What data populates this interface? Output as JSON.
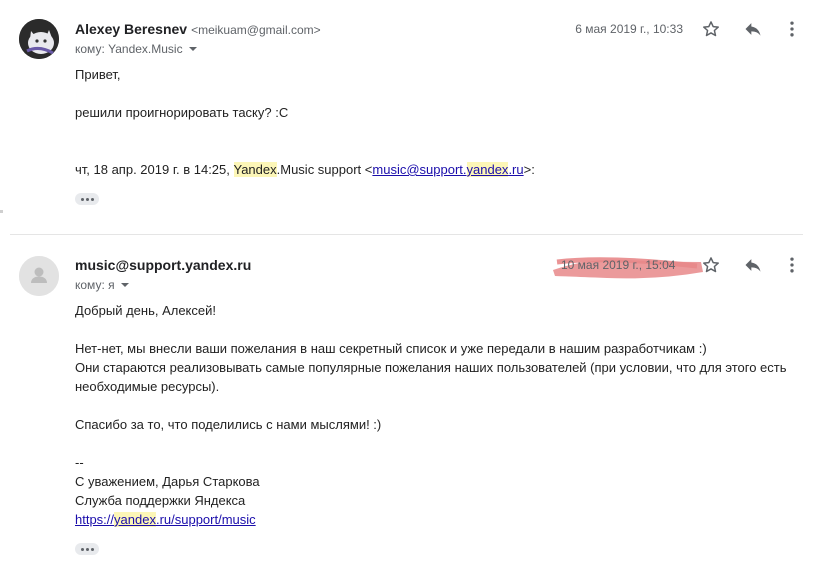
{
  "messages": [
    {
      "sender_name": "Alexey Beresnev",
      "sender_email": "<meikuam@gmail.com>",
      "recipient": "кому: Yandex.Music",
      "date": "6 мая 2019 г., 10:33",
      "greeting": "Привет,",
      "line1": "решили проигнорировать таску? :С",
      "quote_prefix": "чт, 18 апр. 2019 г. в 14:25, ",
      "quote_yandex": "Yandex",
      "quote_rest": ".Music support <",
      "quote_link_a": "music@support.",
      "quote_link_b": "yandex",
      "quote_link_c": ".ru",
      "quote_suffix": ">:"
    },
    {
      "sender_name": "music@support.yandex.ru",
      "recipient": "кому: я",
      "date": "10 мая 2019 г., 15:04",
      "greeting": "Добрый день, Алексей!",
      "p1": "Нет-нет, мы внесли ваши пожелания в наш секретный список и уже передали в нашим разработчикам :)",
      "p2": "Они стараются реализовывать самые популярные пожелания наших пользователей (при условии, что для этого есть",
      "p3": "необходимые ресурсы).",
      "thanks": "Спасибо за то, что поделились с нами мыслями! :)",
      "sig_dash": "--",
      "sig1": "С уважением, Дарья Старкова",
      "sig2": "Служба поддержки Яндекса",
      "link_a": "https://",
      "link_b": "yandex",
      "link_c": ".ru/support/music"
    }
  ],
  "icons": {
    "star": "star-icon",
    "reply": "reply-icon",
    "more": "more-vert-icon",
    "ellipsis": "show-trimmed-content-icon",
    "avatar_default": "person-icon"
  },
  "colors": {
    "highlight": "#fcf6b7",
    "link": "#1a0dab",
    "redaction": "#e8888a"
  }
}
